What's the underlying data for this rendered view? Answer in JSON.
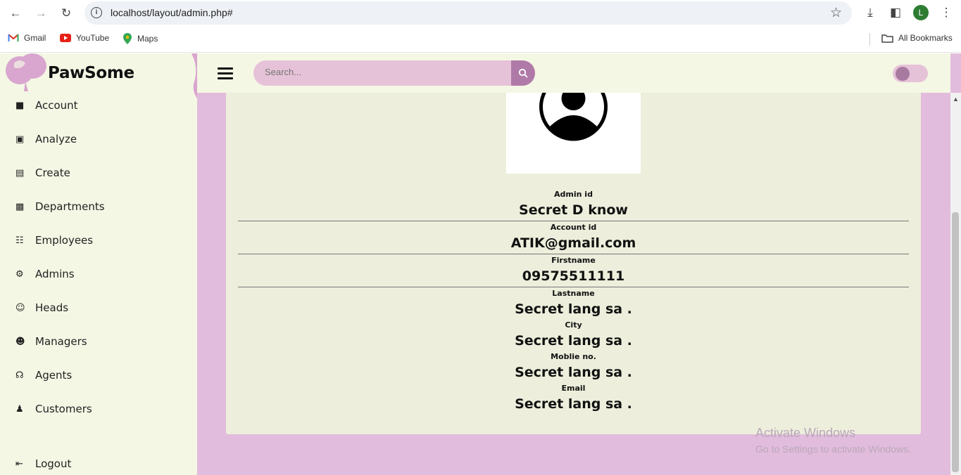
{
  "browser": {
    "url": "localhost/layout/admin.php#",
    "profile_initial": "L",
    "bookmarks": [
      {
        "label": "Gmail",
        "icon": "gmail-icon"
      },
      {
        "label": "YouTube",
        "icon": "youtube-icon"
      },
      {
        "label": "Maps",
        "icon": "maps-icon"
      }
    ],
    "all_bookmarks_label": "All Bookmarks"
  },
  "app": {
    "brand": "PawSome",
    "search_placeholder": "Search...",
    "menu": [
      {
        "label": "Account",
        "icon": "account-icon"
      },
      {
        "label": "Analyze",
        "icon": "book-icon"
      },
      {
        "label": "Create",
        "icon": "calendar-icon"
      },
      {
        "label": "Departments",
        "icon": "building-icon"
      },
      {
        "label": "Employees",
        "icon": "sitemap-icon"
      },
      {
        "label": "Admins",
        "icon": "gear-icon"
      },
      {
        "label": "Heads",
        "icon": "user-plus-icon"
      },
      {
        "label": "Managers",
        "icon": "user-speak-icon"
      },
      {
        "label": "Agents",
        "icon": "headset-icon"
      },
      {
        "label": "Customers",
        "icon": "users-icon"
      }
    ],
    "logout_label": "Logout"
  },
  "profile": {
    "fields": [
      {
        "label": "Admin id",
        "value": "Secret D know"
      },
      {
        "label": "Account id",
        "value": "ATIK@gmail.com"
      },
      {
        "label": "Firstname",
        "value": "09575511111"
      },
      {
        "label": "Lastname",
        "value": "Secret lang sa ."
      },
      {
        "label": "City",
        "value": "Secret lang sa ."
      },
      {
        "label": "Moblie no.",
        "value": "Secret lang sa ."
      },
      {
        "label": "Email",
        "value": "Secret lang sa ."
      }
    ]
  },
  "watermark": {
    "line1": "Activate Windows",
    "line2": "Go to Settings to activate Windows."
  },
  "colors": {
    "sidebar_bg": "#f4f7e4",
    "accent_pink": "#e2bcdc",
    "search_btn": "#b07aa8",
    "card_bg": "#edefdc"
  }
}
